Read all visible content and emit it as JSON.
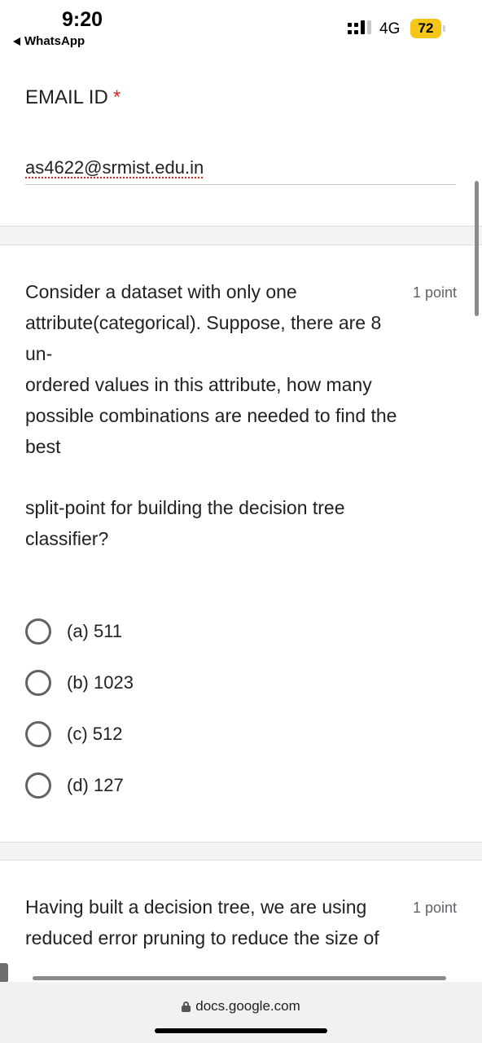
{
  "status_bar": {
    "time": "9:20",
    "back_app": "WhatsApp",
    "network": "4G",
    "battery": "72"
  },
  "email_section": {
    "label": "EMAIL ID",
    "required_mark": "*",
    "value": "as4622@srmist.edu.in"
  },
  "question1": {
    "text_part1": "Consider a dataset with only one attribute(categorical). Suppose, there are 8 un-",
    "text_part2": "ordered values in this attribute, how many possible combinations are needed to find the best",
    "text_part3": "split-point for building the decision tree classifier?",
    "points": "1 point",
    "options": [
      {
        "label": "(a) 511"
      },
      {
        "label": "(b) 1023"
      },
      {
        "label": "(c) 512"
      },
      {
        "label": "(d) 127"
      }
    ]
  },
  "question2": {
    "text": "Having built a decision tree, we are using reduced error pruning to reduce the size of",
    "points": "1 point"
  },
  "browser": {
    "url": "docs.google.com"
  },
  "colors": {
    "required": "#d93025",
    "battery": "#f5c518",
    "radio_border": "#5f6368"
  }
}
